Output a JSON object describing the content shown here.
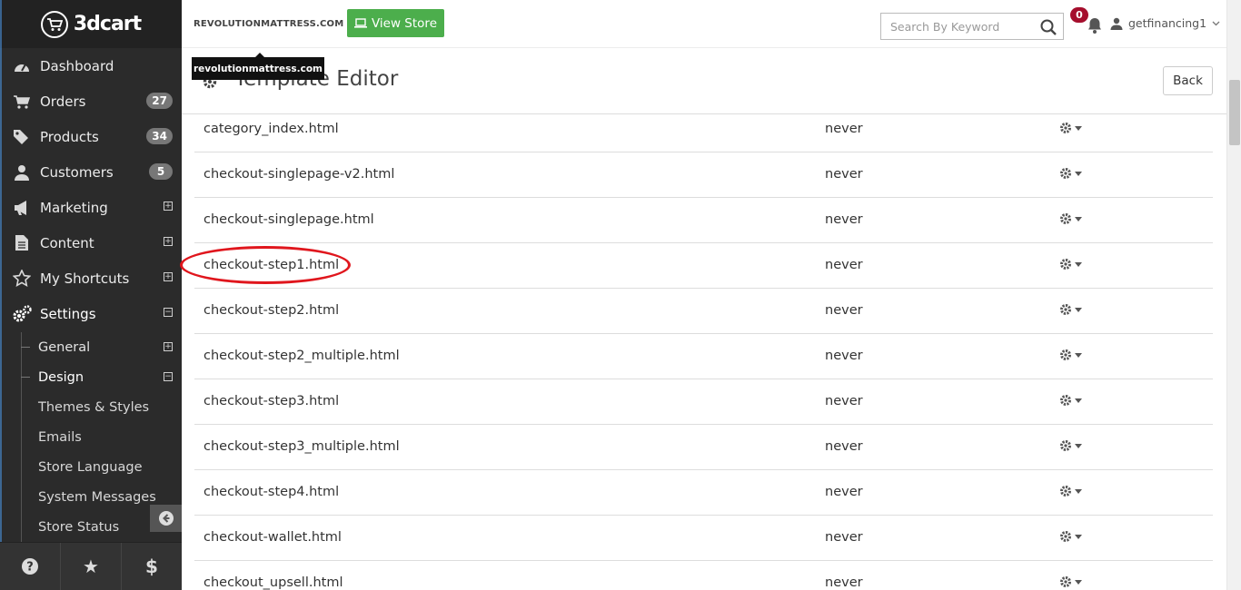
{
  "sidebar": {
    "logo_text": "3dcart",
    "items": [
      {
        "label": "Dashboard",
        "icon": "dashboard-icon"
      },
      {
        "label": "Orders",
        "badge": "27",
        "icon": "cart-icon"
      },
      {
        "label": "Products",
        "badge": "34",
        "icon": "tags-icon"
      },
      {
        "label": "Customers",
        "badge": "5",
        "icon": "user-icon"
      },
      {
        "label": "Marketing",
        "toggle": "⊞",
        "icon": "bullhorn-icon"
      },
      {
        "label": "Content",
        "toggle": "⊞",
        "icon": "file-icon"
      },
      {
        "label": "My Shortcuts",
        "toggle": "⊞",
        "icon": "star-icon"
      },
      {
        "label": "Settings",
        "toggle": "⊟",
        "icon": "gears-icon"
      }
    ],
    "subitems": [
      {
        "label": "General",
        "toggle": "⊞"
      },
      {
        "label": "Design",
        "toggle": "⊟"
      },
      {
        "label": "Themes & Styles"
      },
      {
        "label": "Emails"
      },
      {
        "label": "Store Language"
      },
      {
        "label": "System Messages"
      },
      {
        "label": "Store Status"
      }
    ],
    "bottom": {
      "help": "?",
      "star": "★",
      "dollar": "$"
    }
  },
  "topbar": {
    "store_name": "REVOLUTIONMATTRESS.COM",
    "view_store_label": "View Store",
    "search_placeholder": "Search By Keyword",
    "notification_count": "0",
    "username": "getfinancing1"
  },
  "tooltip": {
    "text": "revolutionmattress.com"
  },
  "page": {
    "title": "Template Editor",
    "back_label": "Back"
  },
  "templates": [
    {
      "name": "category_index.html",
      "modified": "never"
    },
    {
      "name": "checkout-singlepage-v2.html",
      "modified": "never"
    },
    {
      "name": "checkout-singlepage.html",
      "modified": "never"
    },
    {
      "name": "checkout-step1.html",
      "modified": "never",
      "highlighted": true
    },
    {
      "name": "checkout-step2.html",
      "modified": "never"
    },
    {
      "name": "checkout-step2_multiple.html",
      "modified": "never"
    },
    {
      "name": "checkout-step3.html",
      "modified": "never"
    },
    {
      "name": "checkout-step3_multiple.html",
      "modified": "never"
    },
    {
      "name": "checkout-step4.html",
      "modified": "never"
    },
    {
      "name": "checkout-wallet.html",
      "modified": "never"
    },
    {
      "name": "checkout_upsell.html",
      "modified": "never"
    }
  ],
  "colors": {
    "sidebar_bg": "#2b2b2b",
    "view_store_green": "#4cae4c",
    "notification_red": "#a50e2d",
    "highlight_red": "#e0161d"
  }
}
